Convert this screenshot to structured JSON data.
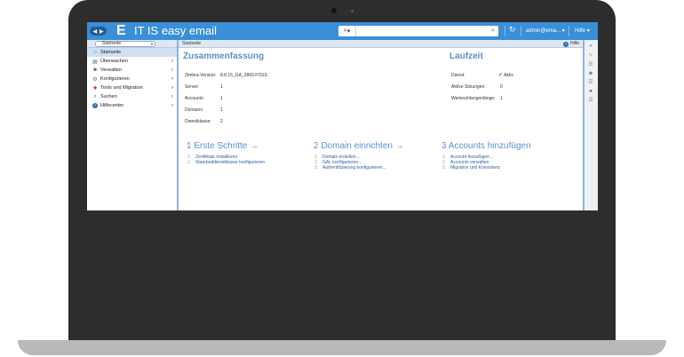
{
  "topbar": {
    "logo": "E",
    "brand": "IT IS easy email",
    "search_placeholder": "",
    "user": "admin@ema...",
    "help": "Hilfe",
    "nav_back": "◀",
    "nav_forward": "▶",
    "caret": "▾"
  },
  "sidebar": {
    "crumb": "Startseite",
    "items": [
      {
        "label": "Startseite",
        "icon": "⌂"
      },
      {
        "label": "Überwachen",
        "icon": "▤"
      },
      {
        "label": "Verwalten",
        "icon": "☻"
      },
      {
        "label": "Konfigurieren",
        "icon": "⚙"
      },
      {
        "label": "Tools und Migration",
        "icon": "✚"
      },
      {
        "label": "Suchen",
        "icon": "⌕"
      },
      {
        "label": "Hilfecenter",
        "icon": "?"
      }
    ],
    "arrow": "›"
  },
  "content": {
    "breadcrumb": "Startseite",
    "help": "Hilfe",
    "summary": {
      "title": "Zusammenfassung",
      "rows": [
        {
          "label": "Zimbra-Version:",
          "value": "8.8.15_GA_3869.FOSS"
        },
        {
          "label": "Server:",
          "value": "1"
        },
        {
          "label": "Accounts:",
          "value": "1"
        },
        {
          "label": "Domains:",
          "value": "1"
        },
        {
          "label": "Dienstklasse:",
          "value": "2"
        }
      ]
    },
    "runtime": {
      "title": "Laufzeit",
      "rows": [
        {
          "label": "Dienst:",
          "value": "Aktiv"
        },
        {
          "label": "Aktive Sitzungen:",
          "value": "0"
        },
        {
          "label": "Warteschlangenlänge:",
          "value": "1"
        }
      ]
    },
    "steps": [
      {
        "title": "1 Erste Schritte →",
        "items": [
          "Zertifikate installieren",
          "Standarddienstklasse konfigurieren"
        ]
      },
      {
        "title": "2 Domain einrichten →",
        "items": [
          "Domain erstellen...",
          "GAL konfigurieren...",
          "Authentifizierung konfigurieren..."
        ]
      },
      {
        "title": "3 Accounts hinzufügen",
        "items": [
          "Account hinzufügen...",
          "Accounts verwalten",
          "Migration und Koexistenz"
        ]
      }
    ]
  },
  "colors": {
    "accent": "#3a8fd6",
    "heading": "#5b8fd0",
    "link": "#2e5fa3",
    "frame": "#2d2d2d"
  }
}
